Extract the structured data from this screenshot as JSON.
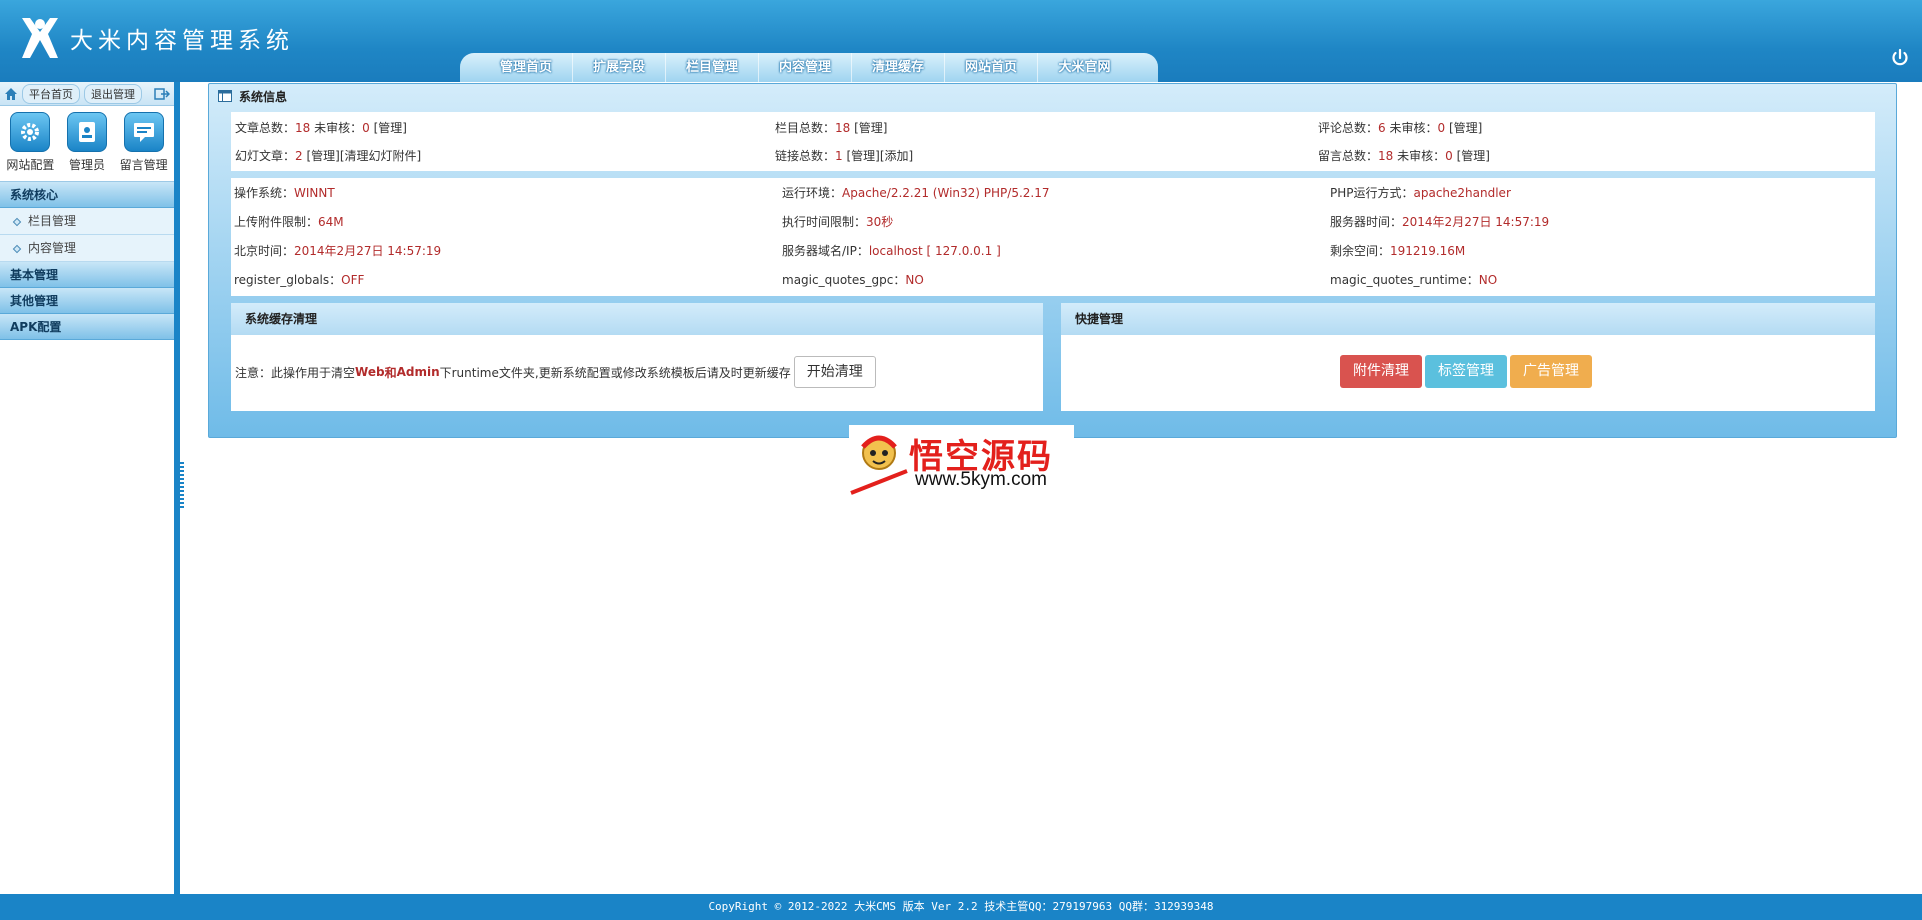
{
  "header": {
    "title": "大米内容管理系统",
    "nav": [
      "管理首页",
      "扩展字段",
      "栏目管理",
      "内容管理",
      "清理缓存",
      "网站首页",
      "大米官网"
    ]
  },
  "sidebar": {
    "top_links": [
      "平台首页",
      "退出管理"
    ],
    "quick": [
      "网站配置",
      "管理员",
      "留言管理"
    ],
    "groups": [
      {
        "title": "系统核心",
        "items": [
          "栏目管理",
          "内容管理"
        ]
      },
      {
        "title": "基本管理",
        "items": []
      },
      {
        "title": "其他管理",
        "items": []
      },
      {
        "title": "APK配置",
        "items": []
      }
    ]
  },
  "sysinfo": {
    "title": "系统信息",
    "stats": {
      "articles": {
        "label": "文章总数：",
        "count": "18",
        "pending_label": "未审核：",
        "pending": "0",
        "link": "[管理]"
      },
      "columns": {
        "label": "栏目总数：",
        "count": "18",
        "link": "[管理]"
      },
      "comments": {
        "label": "评论总数：",
        "count": "6",
        "pending_label": "未审核：",
        "pending": "0",
        "link": "[管理]"
      },
      "slides": {
        "label": "幻灯文章：",
        "count": "2",
        "link1": "[管理]",
        "link2": "[清理幻灯附件]"
      },
      "links": {
        "label": "链接总数：",
        "count": "1",
        "link1": "[管理]",
        "link2": "[添加]"
      },
      "messages": {
        "label": "留言总数：",
        "count": "18",
        "pending_label": "未审核：",
        "pending": "0",
        "link": "[管理]"
      }
    },
    "env": [
      [
        {
          "k": "操作系统：",
          "v": "WINNT"
        },
        {
          "k": "运行环境：",
          "v": "Apache/2.2.21 (Win32) PHP/5.2.17"
        },
        {
          "k": "PHP运行方式：",
          "v": "apache2handler"
        }
      ],
      [
        {
          "k": "上传附件限制：",
          "v": "64M"
        },
        {
          "k": "执行时间限制：",
          "v": "30秒"
        },
        {
          "k": "服务器时间：",
          "v": "2014年2月27日 14:57:19"
        }
      ],
      [
        {
          "k": "北京时间：",
          "v": "2014年2月27日 14:57:19"
        },
        {
          "k": "服务器域名/IP：",
          "v": "localhost [ 127.0.0.1 ]"
        },
        {
          "k": "剩余空间：",
          "v": "191219.16M"
        }
      ],
      [
        {
          "k": "register_globals：",
          "v": "OFF"
        },
        {
          "k": "magic_quotes_gpc：",
          "v": "NO"
        },
        {
          "k": "magic_quotes_runtime：",
          "v": "NO"
        }
      ]
    ]
  },
  "cache": {
    "title": "系统缓存清理",
    "note_prefix": "注意：此操作用于清空",
    "note_web": "Web",
    "note_and": "和",
    "note_admin": "Admin",
    "note_suffix": "下runtime文件夹,更新系统配置或修改系统模板后请及时更新缓存",
    "button": "开始清理"
  },
  "quick_manage": {
    "title": "快捷管理",
    "buttons": [
      {
        "label": "附件清理",
        "color": "#d9534f"
      },
      {
        "label": "标签管理",
        "color": "#5bc0de"
      },
      {
        "label": "广告管理",
        "color": "#f0ad4e"
      }
    ]
  },
  "watermark": {
    "title": "悟空源码",
    "url": "www.5kym.com"
  },
  "footer": "CopyRight © 2012-2022 大米CMS 版本 Ver 2.2 技术主管QQ：279197963 QQ群：312939348"
}
